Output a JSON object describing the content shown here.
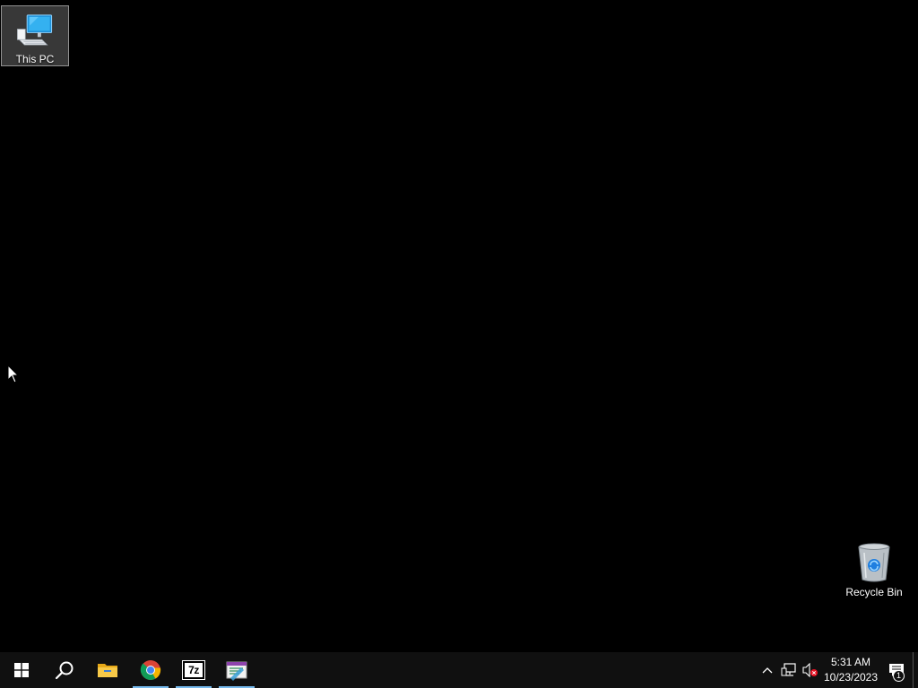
{
  "desktop": {
    "icons": [
      {
        "label": "This PC"
      },
      {
        "label": "Recycle Bin"
      }
    ]
  },
  "taskbar": {
    "start": "start-icon",
    "pinned": [
      {
        "name": "search-icon"
      },
      {
        "name": "file-explorer-icon",
        "running": false
      },
      {
        "name": "chrome-icon",
        "running": true
      },
      {
        "name": "7zip-icon",
        "running": true,
        "text": "7z"
      },
      {
        "name": "editor-icon",
        "running": true
      }
    ],
    "tray": {
      "clock_time": "5:31 AM",
      "clock_date": "10/23/2023",
      "notification_count": "1"
    }
  },
  "colors": {
    "desktop_bg": "#000000",
    "taskbar_bg": "#101010",
    "running_indicator": "#76b9ed"
  }
}
